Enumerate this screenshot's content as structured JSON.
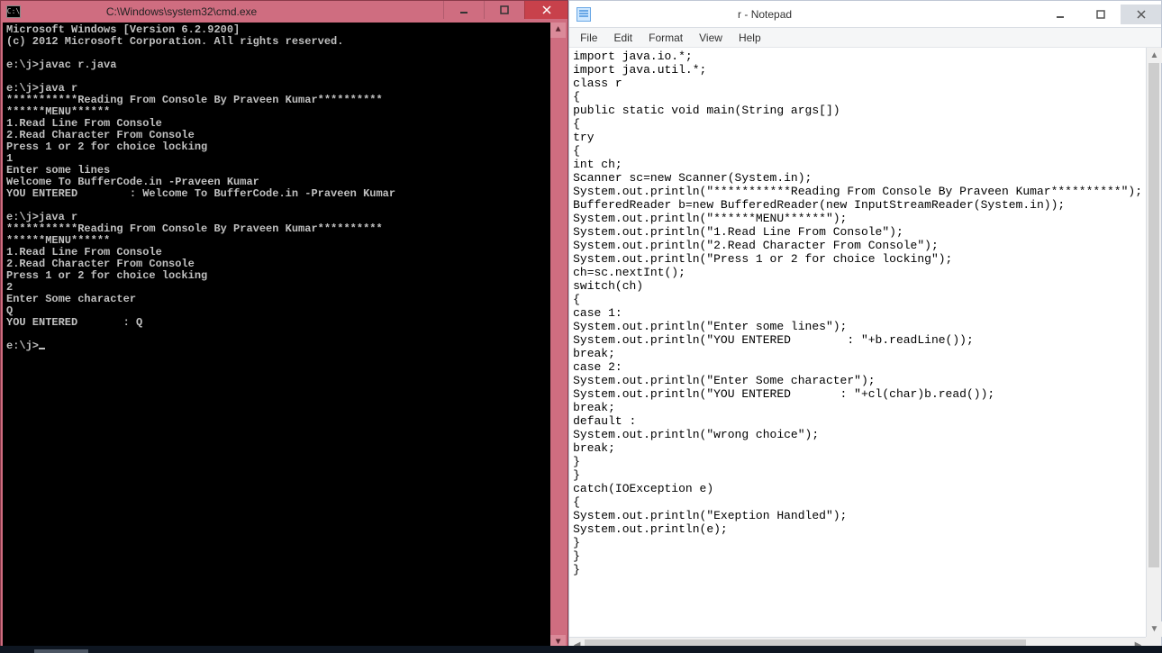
{
  "cmd": {
    "title": "C:\\Windows\\system32\\cmd.exe",
    "icon_label": "C:\\",
    "output": "Microsoft Windows [Version 6.2.9200]\n(c) 2012 Microsoft Corporation. All rights reserved.\n\ne:\\j>javac r.java\n\ne:\\j>java r\n***********Reading From Console By Praveen Kumar**********\n******MENU******\n1.Read Line From Console\n2.Read Character From Console\nPress 1 or 2 for choice locking\n1\nEnter some lines\nWelcome To BufferCode.in -Praveen Kumar\nYOU ENTERED        : Welcome To BufferCode.in -Praveen Kumar\n\ne:\\j>java r\n***********Reading From Console By Praveen Kumar**********\n******MENU******\n1.Read Line From Console\n2.Read Character From Console\nPress 1 or 2 for choice locking\n2\nEnter Some character\nQ\nYOU ENTERED       : Q\n\ne:\\j>"
  },
  "notepad": {
    "title": "r - Notepad",
    "menu": {
      "file": "File",
      "edit": "Edit",
      "format": "Format",
      "view": "View",
      "help": "Help"
    },
    "content": "import java.io.*;\nimport java.util.*;\nclass r\n{\npublic static void main(String args[])\n{\ntry\n{\nint ch;\nScanner sc=new Scanner(System.in);\nSystem.out.println(\"***********Reading From Console By Praveen Kumar**********\");\nBufferedReader b=new BufferedReader(new InputStreamReader(System.in));\nSystem.out.println(\"******MENU******\");\nSystem.out.println(\"1.Read Line From Console\");\nSystem.out.println(\"2.Read Character From Console\");\nSystem.out.println(\"Press 1 or 2 for choice locking\");\nch=sc.nextInt();\nswitch(ch)\n{\ncase 1:\nSystem.out.println(\"Enter some lines\");\nSystem.out.println(\"YOU ENTERED        : \"+b.readLine());\nbreak;\ncase 2:\nSystem.out.println(\"Enter Some character\");\nSystem.out.println(\"YOU ENTERED       : \"+cl(char)b.read());\nbreak;\ndefault :\nSystem.out.println(\"wrong choice\");\nbreak;\n}\n}\ncatch(IOException e)\n{\nSystem.out.println(\"Exeption Handled\");\nSystem.out.println(e);\n}\n}\n}"
  }
}
